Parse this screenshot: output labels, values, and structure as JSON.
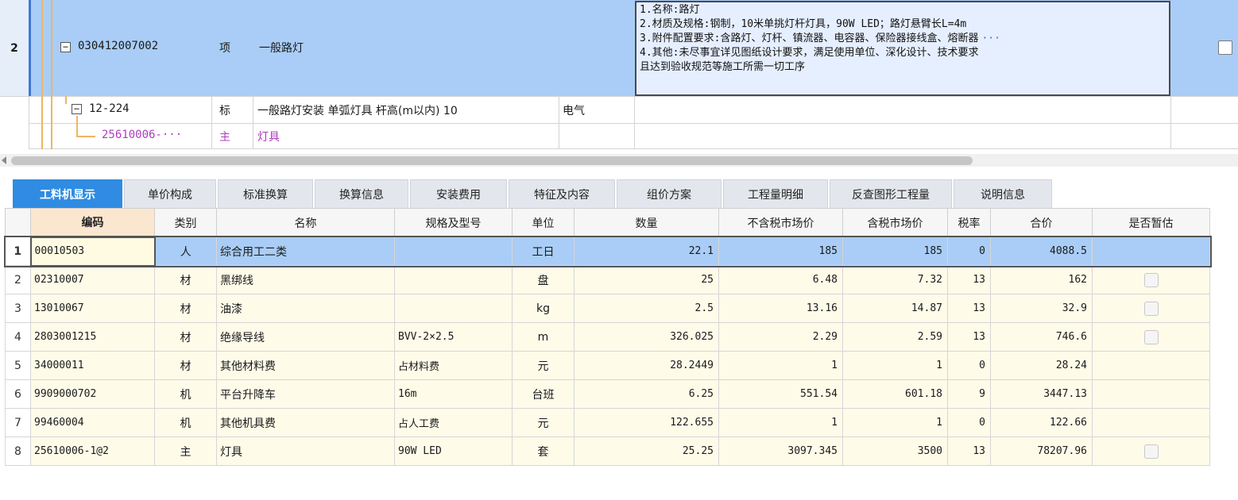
{
  "top": {
    "row2": {
      "row_no": "2",
      "code": "030412007002",
      "type": "项",
      "name": "一般路灯",
      "desc": [
        "1.名称:路灯",
        "2.材质及规格:钢制，10米单挑灯杆灯具，90W LED；路灯悬臂长L=4m",
        "3.附件配置要求:含路灯、灯杆、镇流器、电容器、保险器接线盒、熔断器",
        "4.其他:未尽事宜详见图纸设计要求，满足使用单位、深化设计、技术要求",
        "且达到验收规范等施工所需一切工序"
      ],
      "more": "···"
    },
    "row3": {
      "code": "12-224",
      "type": "标",
      "name": "一般路灯安装 单弧灯具 杆高(m以内) 10",
      "spec": "电气"
    },
    "row4": {
      "code": "25610006-···",
      "type": "主",
      "name": "灯具"
    }
  },
  "tabs": [
    "工料机显示",
    "单价构成",
    "标准换算",
    "换算信息",
    "安装费用",
    "特征及内容",
    "组价方案",
    "工程量明细",
    "反查图形工程量",
    "说明信息"
  ],
  "table": {
    "headers": [
      "编码",
      "类别",
      "名称",
      "规格及型号",
      "单位",
      "数量",
      "不含税市场价",
      "含税市场价",
      "税率",
      "合价",
      "是否暂估"
    ],
    "rows": [
      {
        "no": "1",
        "code": "00010503",
        "cat": "人",
        "name": "综合用工二类",
        "spec": "",
        "unit": "工日",
        "qty": "22.1",
        "price_ex": "185",
        "price_in": "185",
        "tax": "0",
        "total": "4088.5",
        "est": false
      },
      {
        "no": "2",
        "code": "02310007",
        "cat": "材",
        "name": "黑绑线",
        "spec": "",
        "unit": "盘",
        "qty": "25",
        "price_ex": "6.48",
        "price_in": "7.32",
        "tax": "13",
        "total": "162",
        "est": true
      },
      {
        "no": "3",
        "code": "13010067",
        "cat": "材",
        "name": "油漆",
        "spec": "",
        "unit": "kg",
        "qty": "2.5",
        "price_ex": "13.16",
        "price_in": "14.87",
        "tax": "13",
        "total": "32.9",
        "est": true
      },
      {
        "no": "4",
        "code": "2803001215",
        "cat": "材",
        "name": "绝缘导线",
        "spec": "BVV-2×2.5",
        "unit": "m",
        "qty": "326.025",
        "price_ex": "2.29",
        "price_in": "2.59",
        "tax": "13",
        "total": "746.6",
        "est": true
      },
      {
        "no": "5",
        "code": "34000011",
        "cat": "材",
        "name": "其他材料费",
        "spec": "占材料费",
        "unit": "元",
        "qty": "28.2449",
        "price_ex": "1",
        "price_in": "1",
        "tax": "0",
        "total": "28.24",
        "est": false
      },
      {
        "no": "6",
        "code": "9909000702",
        "cat": "机",
        "name": "平台升降车",
        "spec": "16m",
        "unit": "台班",
        "qty": "6.25",
        "price_ex": "551.54",
        "price_in": "601.18",
        "tax": "9",
        "total": "3447.13",
        "est": false
      },
      {
        "no": "7",
        "code": "99460004",
        "cat": "机",
        "name": "其他机具费",
        "spec": "占人工费",
        "unit": "元",
        "qty": "122.655",
        "price_ex": "1",
        "price_in": "1",
        "tax": "0",
        "total": "122.66",
        "est": false
      },
      {
        "no": "8",
        "code": "25610006-1@2",
        "cat": "主",
        "name": "灯具",
        "spec": "90W LED",
        "unit": "套",
        "qty": "25.25",
        "price_ex": "3097.345",
        "price_in": "3500",
        "tax": "13",
        "total": "78207.96",
        "est": true
      }
    ]
  },
  "colors": {
    "selected_row": "#a9cdf6",
    "tab_active": "#2f8ce2",
    "row_bg": "#fefbe9",
    "tree_line": "#f0b463",
    "main_material": "#b03cc0"
  }
}
